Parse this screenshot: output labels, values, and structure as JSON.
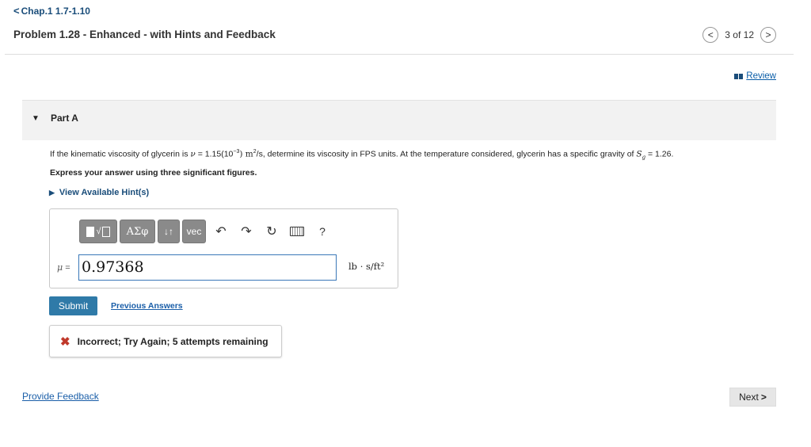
{
  "header": {
    "back_chevron": "<",
    "back_label": "Chap.1 1.7-1.10",
    "problem_title": "Problem 1.28 - Enhanced - with Hints and Feedback",
    "prev_icon": "<",
    "pager_text": "3 of 12",
    "next_icon": ">"
  },
  "review": {
    "icon": "book-icon",
    "label": "Review"
  },
  "part": {
    "caret": "▼",
    "label": "Part A"
  },
  "question": {
    "text_1": "If the kinematic viscosity of glycerin is ",
    "nu": "ν",
    "text_2": " = 1.15(10",
    "exp": "−3",
    "text_3": ") m",
    "sq": "2",
    "text_4": "/s, determine its viscosity in FPS units. At the temperature considered, glycerin has a specific gravity of ",
    "s": "S",
    "sub_g": "g",
    "text_5": " = 1.26.",
    "instruction": "Express your answer using three significant figures.",
    "hints_label": "View Available Hint(s)"
  },
  "toolbar": {
    "greek": "ΑΣφ",
    "arrows": "↓↑",
    "vec": "vec",
    "undo": "↶",
    "redo": "↷",
    "reset": "↻",
    "help": "?"
  },
  "answer": {
    "symbol": "μ",
    "equals": " =",
    "value": "0.97368",
    "units": "lb · s/ft²"
  },
  "actions": {
    "submit": "Submit",
    "previous_answers": "Previous Answers"
  },
  "feedback": {
    "icon": "✖",
    "text": "Incorrect; Try Again; 5 attempts remaining"
  },
  "footer": {
    "provide_feedback": "Provide Feedback",
    "next_label": "Next",
    "next_chevron": ">"
  },
  "colors": {
    "accent": "#2f7aa8",
    "error": "#c0392b",
    "link": "#1a5ea8"
  }
}
